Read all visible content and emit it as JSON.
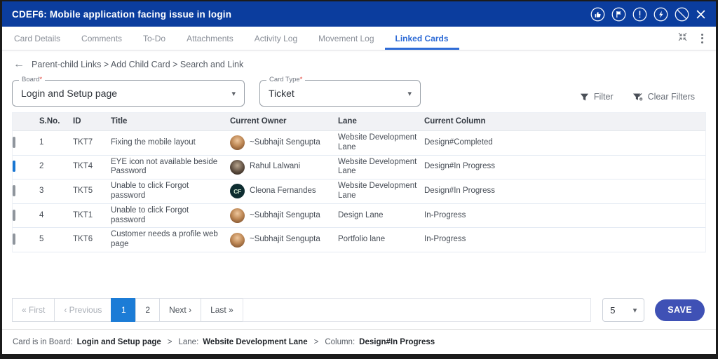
{
  "titlebar": {
    "title": "CDEF6:  Mobile application facing issue in login",
    "icons": [
      "like-icon",
      "flag-icon",
      "alert-icon",
      "bolt-icon",
      "block-icon",
      "close-icon"
    ],
    "bg_color": "#0b3d9e"
  },
  "tabs": {
    "items": [
      {
        "label": "Card Details"
      },
      {
        "label": "Comments"
      },
      {
        "label": "To-Do"
      },
      {
        "label": "Attachments"
      },
      {
        "label": "Activity Log"
      },
      {
        "label": "Movement Log"
      },
      {
        "label": "Linked Cards"
      }
    ],
    "active": "Linked Cards",
    "active_color": "#2e6bd6",
    "action_icons": [
      "collapse-icon",
      "kebab-menu-icon"
    ]
  },
  "breadcrumb": {
    "back_arrow": "←",
    "path": "Parent-child Links > Add Child Card > Search and Link"
  },
  "selectors": {
    "board": {
      "label": "Board",
      "required_mark": "*",
      "value": "Login and Setup page",
      "caret": "▾"
    },
    "card_type": {
      "label": "Card Type",
      "required_mark": "*",
      "value": "Ticket",
      "caret": "▾"
    }
  },
  "filter_tools": {
    "filter_label": "Filter",
    "clear_filters_label": "Clear Filters"
  },
  "table": {
    "headers": {
      "sno": "S.No.",
      "id": "ID",
      "title": "Title",
      "owner": "Current Owner",
      "lane": "Lane",
      "column": "Current Column"
    },
    "rows": [
      {
        "checked": false,
        "sno": "1",
        "id": "TKT7",
        "title": "Fixing the mobile layout",
        "owner": "~Subhajit Sengupta",
        "avatar_text": "",
        "avatar_style": "background:radial-gradient(circle at 50% 35%, #eec79e 0%, #c08a57 45%, #8a5a33 80%, #6b4526 100%)",
        "lane": "Website Development Lane",
        "column": "Design#Completed"
      },
      {
        "checked": true,
        "sno": "2",
        "id": "TKT4",
        "title": "EYE icon not available beside Password",
        "owner": "Rahul Lalwani",
        "avatar_text": "",
        "avatar_style": "background:radial-gradient(circle at 50% 38%, #b9a68f 0%, #5d4d3f 55%, #1c1512 100%)",
        "lane": "Website Development Lane",
        "column": "Design#In Progress"
      },
      {
        "checked": false,
        "sno": "3",
        "id": "TKT5",
        "title": "Unable to click Forgot password",
        "owner": "Cleona Fernandes",
        "avatar_text": "CF",
        "avatar_style": "background:#0e2d30",
        "lane": "Website Development Lane",
        "column": "Design#In Progress"
      },
      {
        "checked": false,
        "sno": "4",
        "id": "TKT1",
        "title": "Unable to click Forgot password",
        "owner": "~Subhajit Sengupta",
        "avatar_text": "",
        "avatar_style": "background:radial-gradient(circle at 50% 35%, #eec79e 0%, #c08a57 45%, #8a5a33 80%, #6b4526 100%)",
        "lane": "Design Lane",
        "column": "In-Progress"
      },
      {
        "checked": false,
        "sno": "5",
        "id": "TKT6",
        "title": "Customer needs a profile web page",
        "owner": "~Subhajit Sengupta",
        "avatar_text": "",
        "avatar_style": "background:radial-gradient(circle at 50% 35%, #eec79e 0%, #c08a57 45%, #8a5a33 80%, #6b4526 100%)",
        "lane": "Portfolio lane",
        "column": "In-Progress"
      }
    ]
  },
  "pagination": {
    "first": "« First",
    "previous": "‹ Previous",
    "page1": "1",
    "page2": "2",
    "next": "Next ›",
    "last": "Last »",
    "active_page": "1",
    "page_size": "5",
    "caret": "▾"
  },
  "save_button": "SAVE",
  "statusbar": {
    "board_label": "Card is in Board:",
    "board_value": "Login and Setup page",
    "separator": ">",
    "lane_label": "Lane:",
    "lane_value": "Website Development Lane",
    "column_label": "Column:",
    "column_value": "Design#In Progress"
  },
  "colors": {
    "titlebar_bg": "#0b3d9e",
    "active_tab": "#2e6bd6",
    "checked_checkbox": "#1976d2",
    "active_page_bg": "#1c7cd6",
    "save_button_bg": "#3f51b5",
    "table_header_bg": "#f1f2f5"
  }
}
